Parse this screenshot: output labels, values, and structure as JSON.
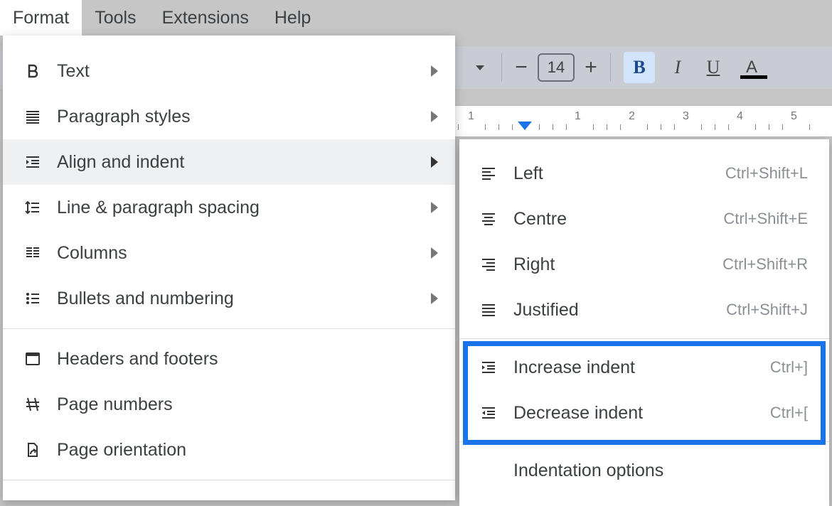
{
  "menubar": {
    "items": [
      {
        "label": "Format",
        "active": true
      },
      {
        "label": "Tools",
        "active": false
      },
      {
        "label": "Extensions",
        "active": false
      },
      {
        "label": "Help",
        "active": false
      }
    ]
  },
  "toolbar": {
    "font_size": "14",
    "bold_label": "B",
    "italic_label": "I",
    "underline_label": "U",
    "textcolor_label": "A"
  },
  "ruler": {
    "ticks": [
      1,
      2,
      3,
      4,
      5
    ],
    "indent_at": 1
  },
  "format_menu": {
    "items": [
      {
        "id": "text",
        "label": "Text",
        "icon": "bold-icon",
        "submenu": true
      },
      {
        "id": "paragraph-styles",
        "label": "Paragraph styles",
        "icon": "paragraph-styles-icon",
        "submenu": true
      },
      {
        "id": "align-indent",
        "label": "Align and indent",
        "icon": "align-indent-icon",
        "submenu": true,
        "hover": true
      },
      {
        "id": "line-spacing",
        "label": "Line & paragraph spacing",
        "icon": "line-spacing-icon",
        "submenu": true
      },
      {
        "id": "columns",
        "label": "Columns",
        "icon": "columns-icon",
        "submenu": true
      },
      {
        "id": "bullets-numbering",
        "label": "Bullets and numbering",
        "icon": "bullets-numbering-icon",
        "submenu": true
      }
    ],
    "items2": [
      {
        "id": "headers-footers",
        "label": "Headers and footers",
        "icon": "headers-footers-icon"
      },
      {
        "id": "page-numbers",
        "label": "Page numbers",
        "icon": "page-numbers-icon"
      },
      {
        "id": "page-orientation",
        "label": "Page orientation",
        "icon": "page-orientation-icon"
      }
    ]
  },
  "align_submenu": {
    "group1": [
      {
        "id": "left",
        "label": "Left",
        "shortcut": "Ctrl+Shift+L",
        "icon": "align-left-icon"
      },
      {
        "id": "centre",
        "label": "Centre",
        "shortcut": "Ctrl+Shift+E",
        "icon": "align-centre-icon"
      },
      {
        "id": "right",
        "label": "Right",
        "shortcut": "Ctrl+Shift+R",
        "icon": "align-right-icon"
      },
      {
        "id": "justified",
        "label": "Justified",
        "shortcut": "Ctrl+Shift+J",
        "icon": "align-justified-icon"
      }
    ],
    "group2": [
      {
        "id": "increase-indent",
        "label": "Increase indent",
        "shortcut": "Ctrl+]",
        "icon": "increase-indent-icon"
      },
      {
        "id": "decrease-indent",
        "label": "Decrease indent",
        "shortcut": "Ctrl+[",
        "icon": "decrease-indent-icon"
      }
    ],
    "group3": [
      {
        "id": "indentation-options",
        "label": "Indentation options",
        "shortcut": "",
        "icon": ""
      }
    ]
  },
  "highlight": {
    "target": "indent-group"
  }
}
